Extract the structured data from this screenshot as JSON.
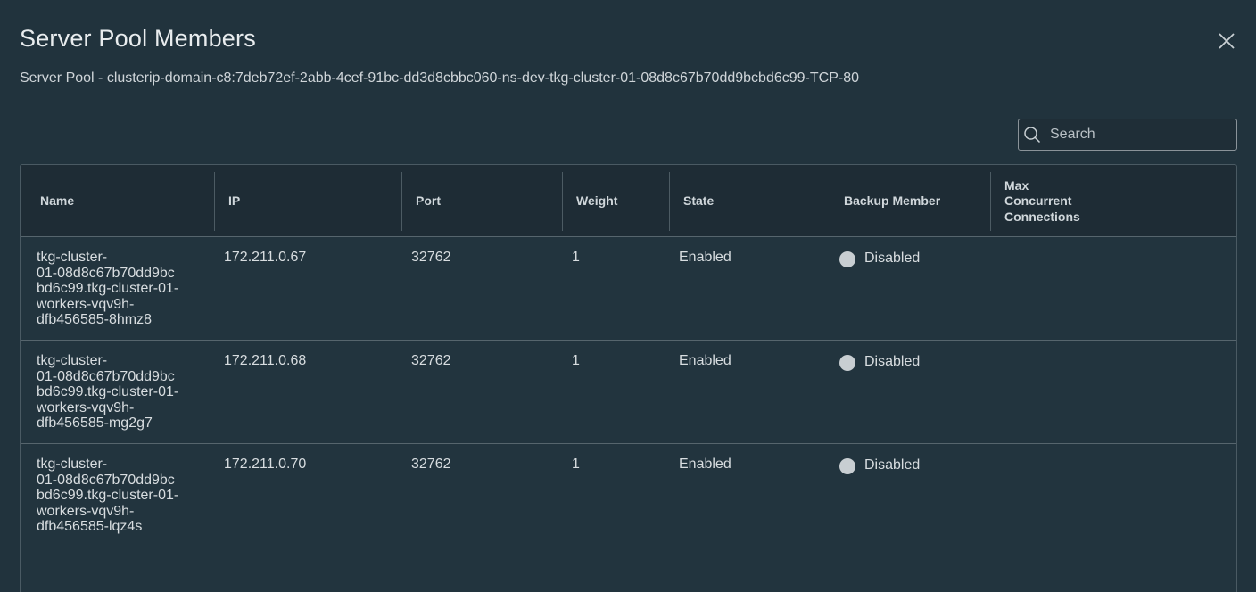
{
  "modal": {
    "title": "Server Pool Members",
    "subtitle": "Server Pool - clusterip-domain-c8:7deb72ef-2abb-4cef-91bc-dd3d8cbbc060-ns-dev-tkg-cluster-01-08d8c67b70dd9bcbd6c99-TCP-80",
    "close_icon": "close-icon"
  },
  "search": {
    "placeholder": "Search",
    "icon": "search-icon"
  },
  "table": {
    "columns": [
      "Name",
      "IP",
      "Port",
      "Weight",
      "State",
      "Backup Member",
      "Max Concurrent Connections"
    ],
    "rows": [
      {
        "name": "tkg-cluster-01-08d8c67b70dd9bcbd6c99.tkg-cluster-01-workers-vqv9h-dfb456585-8hmz8",
        "name_lines": [
          "tkg-cluster-",
          "01-08d8c67b70dd9bc",
          "bd6c99.tkg-cluster-01-",
          "workers-vqv9h-",
          "dfb456585-8hmz8"
        ],
        "ip": "172.211.0.67",
        "port": "32762",
        "weight": "1",
        "state": "Enabled",
        "backup": "Disabled",
        "max_conn": ""
      },
      {
        "name": "tkg-cluster-01-08d8c67b70dd9bcbd6c99.tkg-cluster-01-workers-vqv9h-dfb456585-mg2g7",
        "name_lines": [
          "tkg-cluster-",
          "01-08d8c67b70dd9bc",
          "bd6c99.tkg-cluster-01-",
          "workers-vqv9h-",
          "dfb456585-mg2g7"
        ],
        "ip": "172.211.0.68",
        "port": "32762",
        "weight": "1",
        "state": "Enabled",
        "backup": "Disabled",
        "max_conn": ""
      },
      {
        "name": "tkg-cluster-01-08d8c67b70dd9bcbd6c99.tkg-cluster-01-workers-vqv9h-dfb456585-lqz4s",
        "name_lines": [
          "tkg-cluster-",
          "01-08d8c67b70dd9bc",
          "bd6c99.tkg-cluster-01-",
          "workers-vqv9h-",
          "dfb456585-lqz4s"
        ],
        "ip": "172.211.0.70",
        "port": "32762",
        "weight": "1",
        "state": "Enabled",
        "backup": "Disabled",
        "max_conn": ""
      }
    ]
  },
  "colors": {
    "background": "#21333d",
    "header": "#1e2c35",
    "status_dot": "#c8ced2"
  }
}
